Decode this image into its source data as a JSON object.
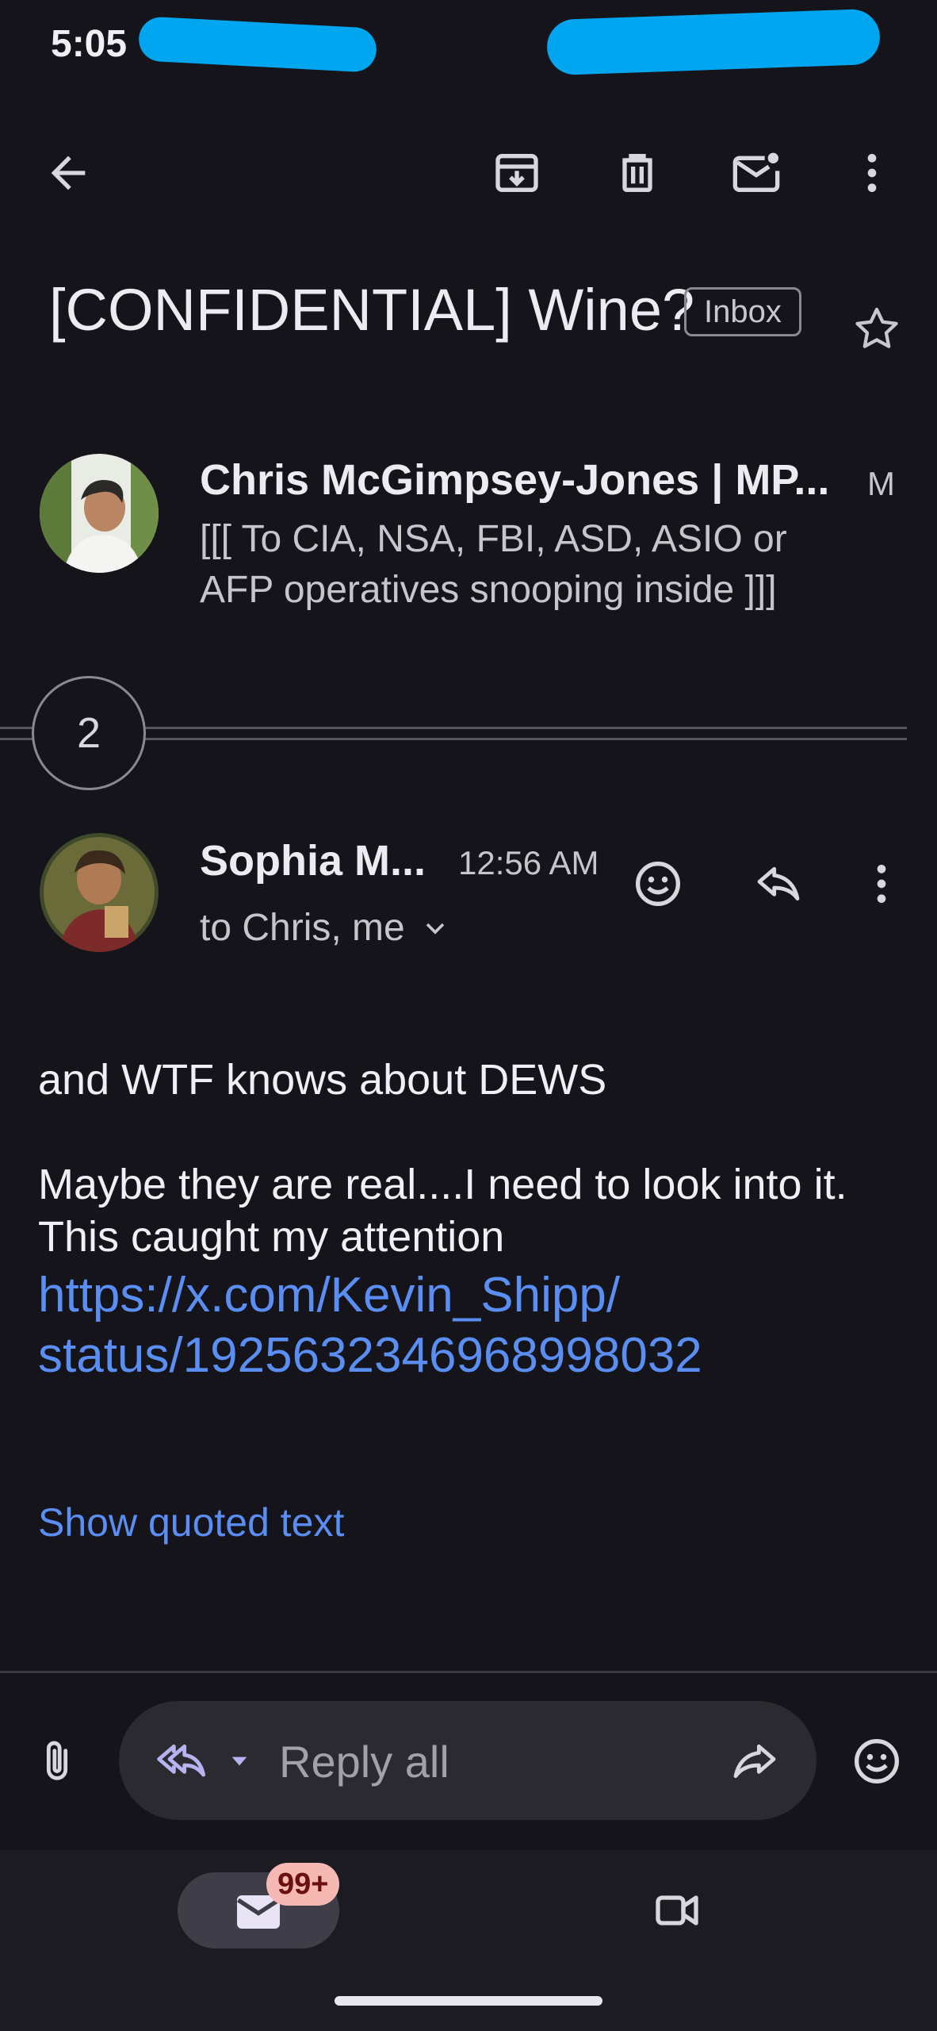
{
  "status_bar": {
    "time": "5:05"
  },
  "subject": {
    "title": "[CONFIDENTIAL] Wine?",
    "label": "Inbox"
  },
  "thread": {
    "first": {
      "sender": "Chris McGimpsey-Jones | MP...",
      "initial": "M",
      "snippet_line1": "[[[ To CIA, NSA, FBI, ASD, ASIO or",
      "snippet_line2": "AFP operatives snooping inside ]]]"
    },
    "collapsed_count": "2",
    "latest": {
      "sender": "Sophia M...",
      "time": "12:56 AM",
      "recipients": "to Chris, me",
      "body_line1": "and WTF knows about DEWS",
      "body_line2": "Maybe they are real....I need to look into it.",
      "body_line3": "This caught my attention",
      "link_line1": "https://x.com/Kevin_Shipp/",
      "link_line2": "status/1925632346968998032",
      "show_quoted": "Show quoted text"
    }
  },
  "reply_bar": {
    "placeholder": "Reply all"
  },
  "bottom_nav": {
    "mail_badge": "99+"
  },
  "colors": {
    "background": "#14141a",
    "link": "#5a8ef3",
    "redaction": "#00a6f0",
    "badge": "#f5b8b2"
  },
  "icons": [
    "back-arrow-icon",
    "archive-icon",
    "trash-icon",
    "mark-unread-icon",
    "more-vert-icon",
    "star-icon",
    "chevron-down-icon",
    "emoji-icon",
    "reply-icon",
    "attach-icon",
    "reply-all-icon",
    "dropdown-icon",
    "forward-icon",
    "mail-icon",
    "video-icon"
  ]
}
